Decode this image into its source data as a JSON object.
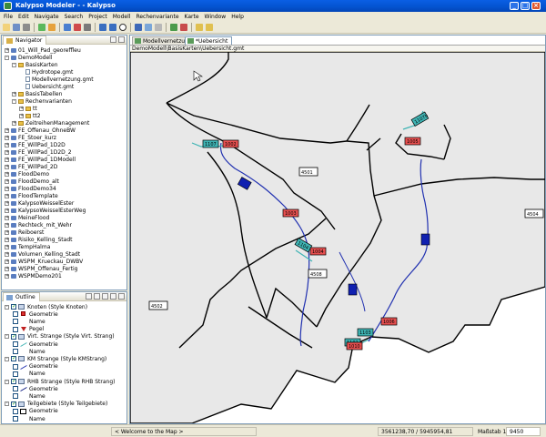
{
  "window": {
    "title": "Kalypso Modeler - - Kalypso"
  },
  "menu": [
    "File",
    "Edit",
    "Navigate",
    "Search",
    "Project",
    "Modell",
    "Rechenvariante",
    "Karte",
    "Window",
    "Help"
  ],
  "navigator": {
    "tab": "Navigator",
    "items": [
      {
        "label": "01_Will_Pad_georeffleu",
        "level": 0,
        "kind": "proj",
        "exp": "+"
      },
      {
        "label": "DemoModell",
        "level": 0,
        "kind": "proj",
        "exp": "-"
      },
      {
        "label": "BasisKarten",
        "level": 1,
        "kind": "fold",
        "exp": "-"
      },
      {
        "label": "Hydrotope.gmt",
        "level": 2,
        "kind": "file",
        "exp": ""
      },
      {
        "label": "Modellvernetzung.gmt",
        "level": 2,
        "kind": "file",
        "exp": ""
      },
      {
        "label": "Uebersicht.gmt",
        "level": 2,
        "kind": "file",
        "exp": ""
      },
      {
        "label": "BasisTabellen",
        "level": 1,
        "kind": "fold",
        "exp": "+"
      },
      {
        "label": "Rechenvarianten",
        "level": 1,
        "kind": "fold",
        "exp": "-"
      },
      {
        "label": "tt",
        "level": 2,
        "kind": "fold",
        "exp": "+"
      },
      {
        "label": "tt2",
        "level": 2,
        "kind": "fold",
        "exp": "+"
      },
      {
        "label": "ZeitreihenManagement",
        "level": 1,
        "kind": "fold",
        "exp": "+"
      },
      {
        "label": "FE_Offenau_OhneBW",
        "level": 0,
        "kind": "proj",
        "exp": "+"
      },
      {
        "label": "FE_Stoer_kurz",
        "level": 0,
        "kind": "proj",
        "exp": "+"
      },
      {
        "label": "FE_WillPad_1D2D",
        "level": 0,
        "kind": "proj",
        "exp": "+"
      },
      {
        "label": "FE_WillPad_1D2D_2",
        "level": 0,
        "kind": "proj",
        "exp": "+"
      },
      {
        "label": "FE_WillPad_1DModell",
        "level": 0,
        "kind": "proj",
        "exp": "+"
      },
      {
        "label": "FE_WillPad_2D",
        "level": 0,
        "kind": "proj",
        "exp": "+"
      },
      {
        "label": "FloodDemo",
        "level": 0,
        "kind": "proj",
        "exp": "+"
      },
      {
        "label": "FloodDemo_alt",
        "level": 0,
        "kind": "proj",
        "exp": "+"
      },
      {
        "label": "FloodDemo34",
        "level": 0,
        "kind": "proj",
        "exp": "+"
      },
      {
        "label": "FloodTemplate",
        "level": 0,
        "kind": "proj",
        "exp": "+"
      },
      {
        "label": "KalypsoWeisselEster",
        "level": 0,
        "kind": "proj",
        "exp": "+"
      },
      {
        "label": "KalypsoWeisselEsterWeg",
        "level": 0,
        "kind": "proj",
        "exp": "+"
      },
      {
        "label": "MeineFlood",
        "level": 0,
        "kind": "proj",
        "exp": "+"
      },
      {
        "label": "Rechteck_mit_Wehr",
        "level": 0,
        "kind": "proj",
        "exp": "+"
      },
      {
        "label": "Reiboerst",
        "level": 0,
        "kind": "proj",
        "exp": "+"
      },
      {
        "label": "Risiko_Kelling_Stadt",
        "level": 0,
        "kind": "proj",
        "exp": "+"
      },
      {
        "label": "TempHalma",
        "level": 0,
        "kind": "proj",
        "exp": "+"
      },
      {
        "label": "Volumen_Kelling_Stadt",
        "level": 0,
        "kind": "proj",
        "exp": "+"
      },
      {
        "label": "WSPM_Krueckau_DWBV",
        "level": 0,
        "kind": "proj",
        "exp": "+"
      },
      {
        "label": "WSPM_Offenau_Fertig",
        "level": 0,
        "kind": "proj",
        "exp": "+"
      },
      {
        "label": "WSPMDemo201",
        "level": 0,
        "kind": "proj",
        "exp": "+"
      }
    ]
  },
  "outline": {
    "tab": "Outline",
    "items": [
      {
        "label": "Knoten (Style Knoten)",
        "level": 0,
        "check": true,
        "sym": "layer"
      },
      {
        "label": "Geometrie",
        "level": 1,
        "check": false,
        "sym": "node-red"
      },
      {
        "label": "Name",
        "level": 1,
        "check": false,
        "sym": ""
      },
      {
        "label": "Pegel",
        "level": 1,
        "check": false,
        "sym": "triangle"
      },
      {
        "label": "Virt. Strange (Style Virt. Strang)",
        "level": 0,
        "check": true,
        "sym": "layer"
      },
      {
        "label": "Geometrie",
        "level": 1,
        "check": false,
        "sym": "line-teal"
      },
      {
        "label": "Name",
        "level": 1,
        "check": false,
        "sym": ""
      },
      {
        "label": "KM Strange (Style KMStrang)",
        "level": 0,
        "check": true,
        "sym": "layer"
      },
      {
        "label": "Geometrie",
        "level": 1,
        "check": false,
        "sym": "line-blue"
      },
      {
        "label": "Name",
        "level": 1,
        "check": false,
        "sym": ""
      },
      {
        "label": "RHB Strange (Style RHB Strang)",
        "level": 0,
        "check": true,
        "sym": "layer"
      },
      {
        "label": "Geometrie",
        "level": 1,
        "check": false,
        "sym": "line-dblue"
      },
      {
        "label": "Name",
        "level": 1,
        "check": false,
        "sym": ""
      },
      {
        "label": "Teilgebiete (Style Teilgebiete)",
        "level": 0,
        "check": true,
        "sym": "layer"
      },
      {
        "label": "Geometrie",
        "level": 1,
        "check": false,
        "sym": "poly"
      },
      {
        "label": "Name",
        "level": 1,
        "check": false,
        "sym": ""
      }
    ]
  },
  "editor": {
    "tabs": [
      {
        "label": "Modellvernetzung",
        "active": false
      },
      {
        "label": "*Uebersicht",
        "active": true
      }
    ],
    "breadcrumb": "DemoModell\\BasisKarten\\Uebersicht.gmt"
  },
  "map": {
    "area_labels": [
      "4501",
      "4508",
      "4502",
      "4504"
    ],
    "node_labels": [
      "1002",
      "1005",
      "1003",
      "1004",
      "1006",
      "1010"
    ],
    "strand_labels": [
      "1107",
      "1107b",
      "1104",
      "1103",
      "1102"
    ]
  },
  "status": {
    "welcome": "< Welcome to the Map >",
    "coords": "3561238,70 / 5945954,81",
    "scale_label": "Maßstab 1 :",
    "scale_value": "9450"
  },
  "colors": {
    "titlebar": "#0a5fe4",
    "node": "#e85050",
    "strand": "#3fb4b4",
    "river": "#2030b0",
    "catchment": "#e8e8e8"
  }
}
